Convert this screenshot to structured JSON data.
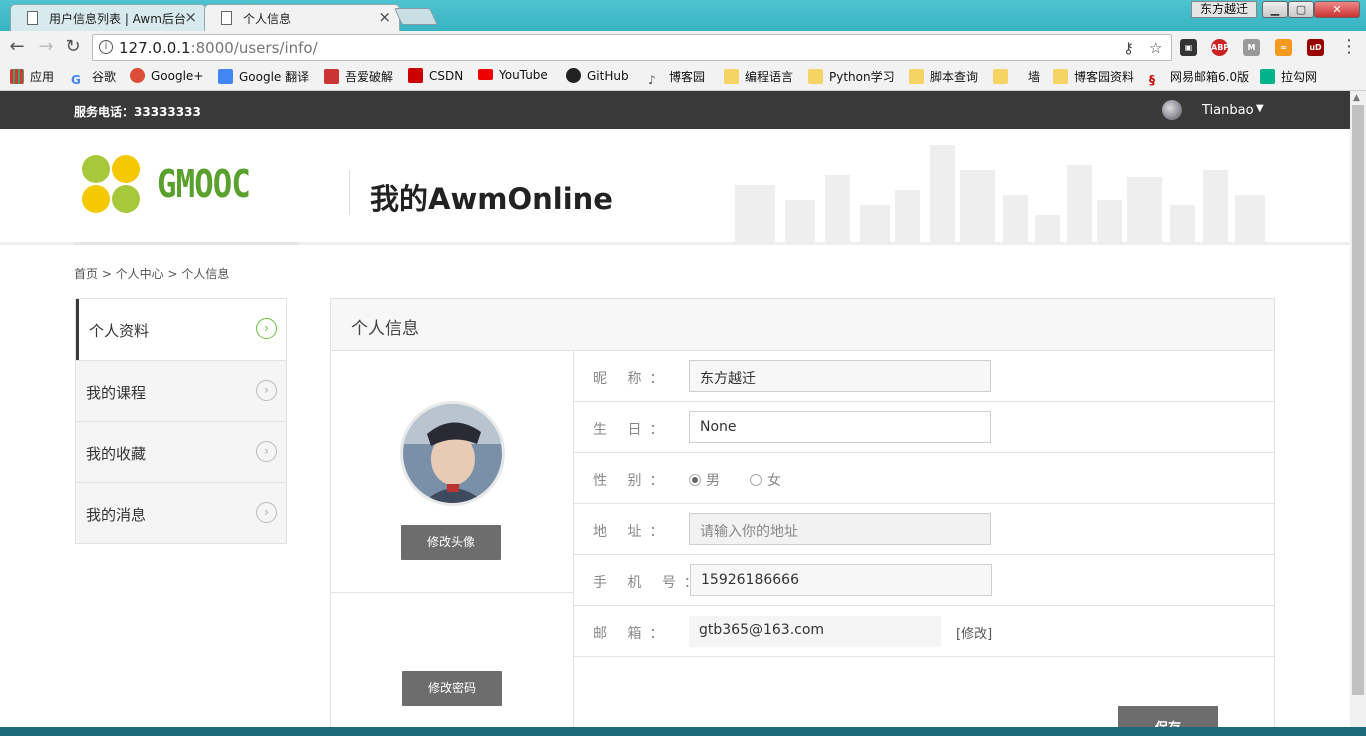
{
  "browser": {
    "tabs": [
      {
        "label": "用户信息列表 | Awm后台",
        "active": false
      },
      {
        "label": "个人信息",
        "active": true
      }
    ],
    "window_user": "东方越迁",
    "url_host": "127.0.0.1",
    "url_path": ":8000/users/info/",
    "bookmarks": [
      "应用",
      "谷歌",
      "Google+",
      "Google 翻译",
      "吾爱破解",
      "CSDN",
      "YouTube",
      "GitHub",
      "博客园",
      "编程语言",
      "Python学习",
      "脚本查询",
      "墙",
      "博客园资料",
      "网易邮箱6.0版",
      "拉勾网"
    ],
    "extensions": [
      "ABP",
      "uD"
    ]
  },
  "topbar": {
    "phone_label": "服务电话：",
    "phone_number": "33333333",
    "username": "Tianbao"
  },
  "header": {
    "logo_text": "GMOOC",
    "site_title": "我的AwmOnline"
  },
  "breadcrumb": "首页 > 个人中心 > 个人信息",
  "sidenav": [
    {
      "label": "个人资料",
      "active": true
    },
    {
      "label": "我的课程",
      "active": false
    },
    {
      "label": "我的收藏",
      "active": false
    },
    {
      "label": "我的消息",
      "active": false
    }
  ],
  "panel": {
    "title": "个人信息",
    "change_avatar": "修改头像",
    "change_password": "修改密码",
    "fields": {
      "nickname_label": "昵 称：",
      "nickname": "东方越迁",
      "birthday_label": "生 日：",
      "birthday": "None",
      "gender_label": "性 别：",
      "gender_male": "男",
      "gender_female": "女",
      "gender_selected": "男",
      "address_label": "地 址：",
      "address_placeholder": "请输入你的地址",
      "mobile_label": "手 机 号：",
      "mobile": "15926186666",
      "email_label": "邮 箱：",
      "email": "gtb365@163.com",
      "email_edit": "[修改]"
    },
    "save": "保存"
  },
  "colors": {
    "accent_green": "#5aa02c",
    "topbar": "#393939",
    "button_gray": "#6d6d6d"
  }
}
